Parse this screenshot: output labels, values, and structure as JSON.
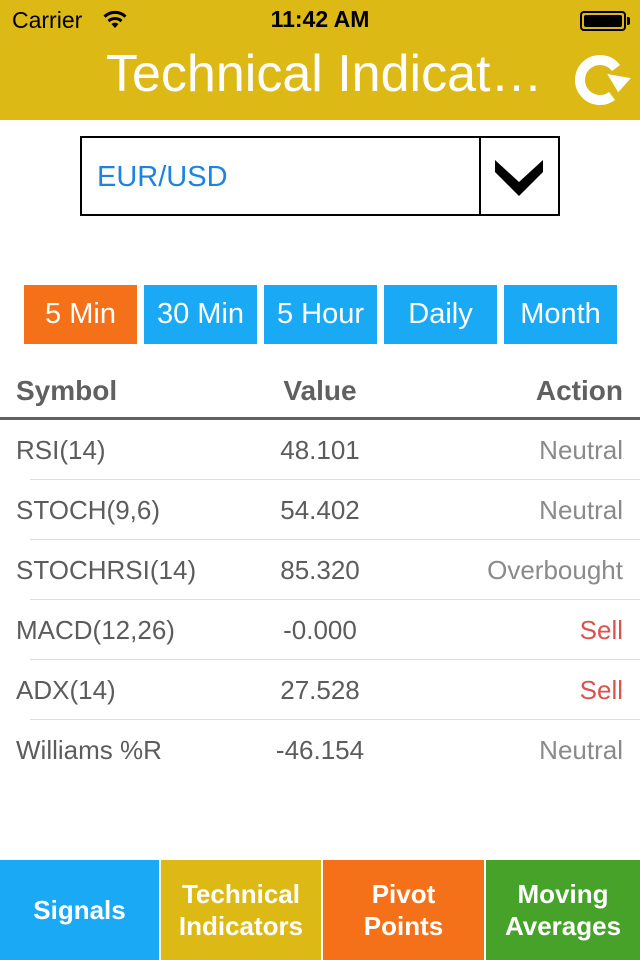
{
  "status_bar": {
    "carrier": "Carrier",
    "time": "11:42 AM",
    "wifi_icon": "wifi-icon",
    "battery_icon": "battery-icon"
  },
  "header": {
    "title": "Technical Indicat…",
    "refresh_icon": "refresh-icon",
    "background_color": "#dcb915"
  },
  "pair_picker": {
    "selected": "EUR/USD",
    "dropdown_icon": "chevron-down-icon"
  },
  "timeframes": {
    "items": [
      {
        "label": "5 Min",
        "active": true
      },
      {
        "label": "30 Min",
        "active": false
      },
      {
        "label": "5 Hour",
        "active": false
      },
      {
        "label": "Daily",
        "active": false
      },
      {
        "label": "Month",
        "active": false
      }
    ],
    "active_color": "#f4711a",
    "inactive_color": "#1aa9f4"
  },
  "table": {
    "columns": [
      "Symbol",
      "Value",
      "Action"
    ],
    "rows": [
      {
        "symbol": "RSI(14)",
        "value": "48.101",
        "action": "Neutral"
      },
      {
        "symbol": "STOCH(9,6)",
        "value": "54.402",
        "action": "Neutral"
      },
      {
        "symbol": "STOCHRSI(14)",
        "value": "85.320",
        "action": "Overbought"
      },
      {
        "symbol": "MACD(12,26)",
        "value": "-0.000",
        "action": "Sell"
      },
      {
        "symbol": "ADX(14)",
        "value": "27.528",
        "action": "Sell"
      },
      {
        "symbol": "Williams %R",
        "value": "-46.154",
        "action": "Neutral"
      }
    ],
    "sell_color": "#d9534f"
  },
  "tabbar": {
    "items": [
      {
        "line1": "Signals",
        "line2": "",
        "color": "#1aa9f4"
      },
      {
        "line1": "Technical",
        "line2": "Indicators",
        "color": "#dcb915"
      },
      {
        "line1": "Pivot",
        "line2": "Points",
        "color": "#f4711a"
      },
      {
        "line1": "Moving",
        "line2": "Averages",
        "color": "#47a22a"
      }
    ]
  }
}
